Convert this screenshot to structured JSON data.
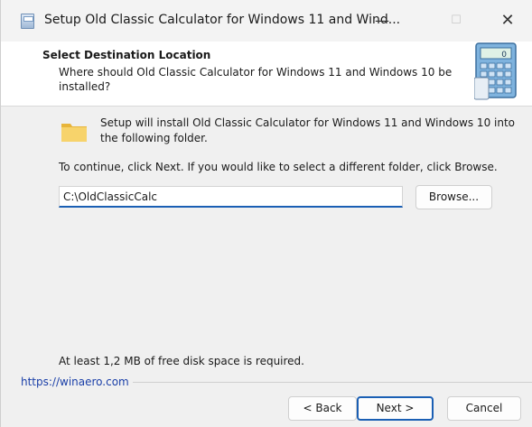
{
  "window": {
    "title": "Setup Old Classic Calculator for Windows 11 and Wind...",
    "minimize_glyph": "—",
    "maximize_glyph": "☐",
    "close_glyph": "✕"
  },
  "header": {
    "title": "Select Destination Location",
    "subtitle": "Where should Old Classic Calculator for Windows 11 and Windows 10 be installed?",
    "icon": "calculator-icon"
  },
  "body": {
    "folder_icon": "folder-icon",
    "install_text": "Setup will install Old Classic Calculator for Windows 11 and Windows 10 into the following folder.",
    "continue_text": "To continue, click Next. If you would like to select a different folder, click Browse.",
    "path_value": "C:\\OldClassicCalc",
    "browse_label": "Browse...",
    "diskspace_text": "At least 1,2 MB of free disk space is required."
  },
  "footer": {
    "link_text": "https://winaero.com",
    "back_label": "< Back",
    "next_label": "Next >",
    "cancel_label": "Cancel"
  },
  "colors": {
    "accent": "#1a5fb4",
    "link": "#1a3fa8",
    "folder": "#f2c94c"
  }
}
